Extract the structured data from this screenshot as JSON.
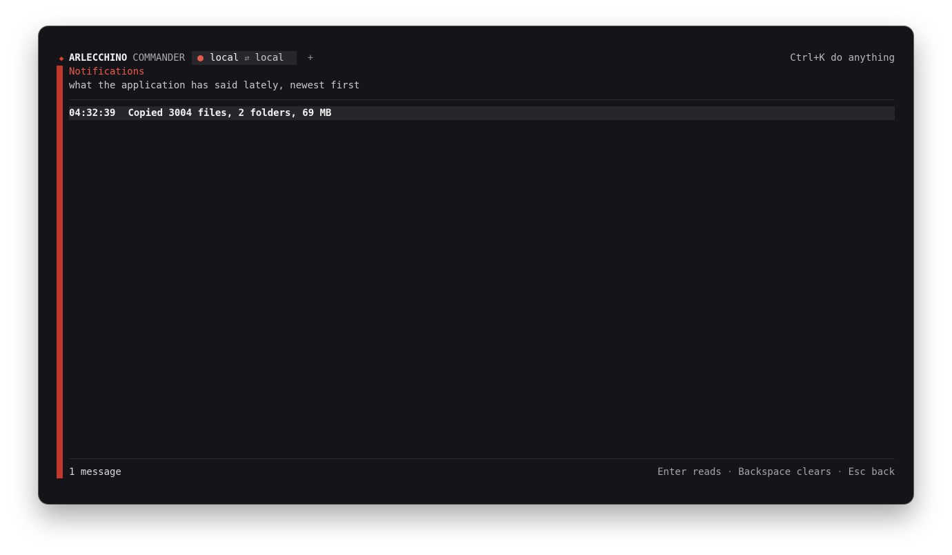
{
  "app": {
    "brand_primary": "ARLECCHINO",
    "brand_secondary": "COMMANDER",
    "accent_color": "#c0392b"
  },
  "tab": {
    "left_pane": "local",
    "swap_icon": "⇄",
    "right_pane": "local",
    "status_color": "#e05b4b"
  },
  "new_tab_label": "+",
  "command_hint": "Ctrl+K do anything",
  "panel": {
    "title": "Notifications",
    "subtitle": "what the application has said lately, newest first"
  },
  "messages": [
    {
      "time": "04:32:39",
      "text": "Copied 3004 files, 2 folders, 69 MB"
    }
  ],
  "footer": {
    "count": "1 message",
    "hint_enter": "Enter reads",
    "hint_backspace": "Backspace clears",
    "hint_esc": "Esc back",
    "separator": "·"
  }
}
